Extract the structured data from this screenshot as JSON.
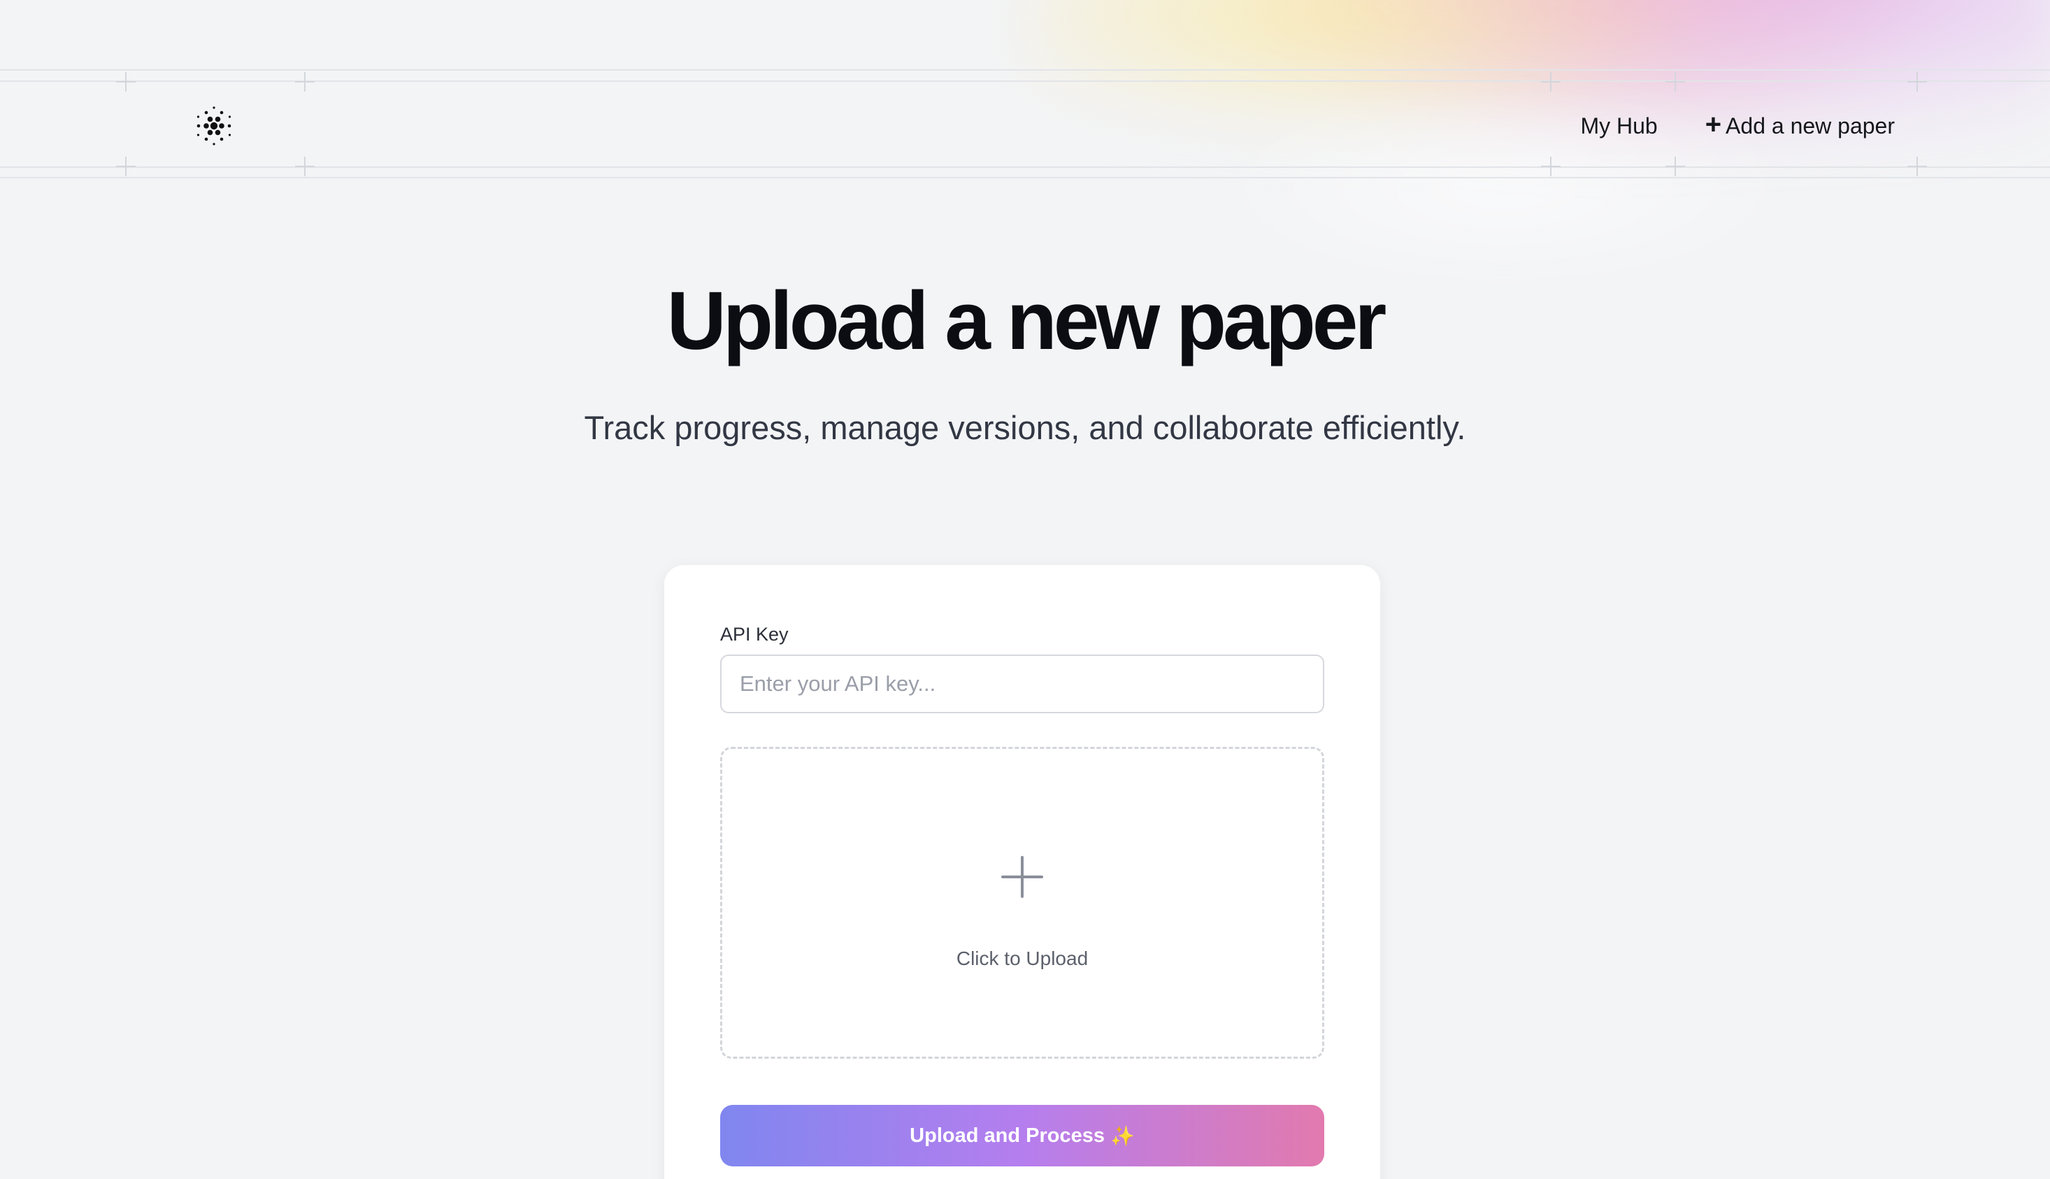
{
  "header": {
    "logo_icon": "dotted-circle-logo-icon",
    "nav": {
      "my_hub": "My Hub",
      "add_paper_icon": "plus-icon",
      "add_paper": "Add a new paper"
    }
  },
  "hero": {
    "title": "Upload a new paper",
    "subtitle": "Track progress, manage versions, and collaborate efficiently."
  },
  "form": {
    "api_key_label": "API Key",
    "api_key_value": "",
    "api_key_placeholder": "Enter your API key...",
    "dropzone_icon": "plus-icon",
    "dropzone_label": "Click to Upload",
    "submit_label": "Upload and Process",
    "submit_icon": "sparkles-icon",
    "submit_glyph": "✨"
  },
  "colors": {
    "background": "#f3f4f6",
    "button_gradient_start": "#8086ef",
    "button_gradient_mid": "#b57eee",
    "button_gradient_end": "#e27aae"
  }
}
